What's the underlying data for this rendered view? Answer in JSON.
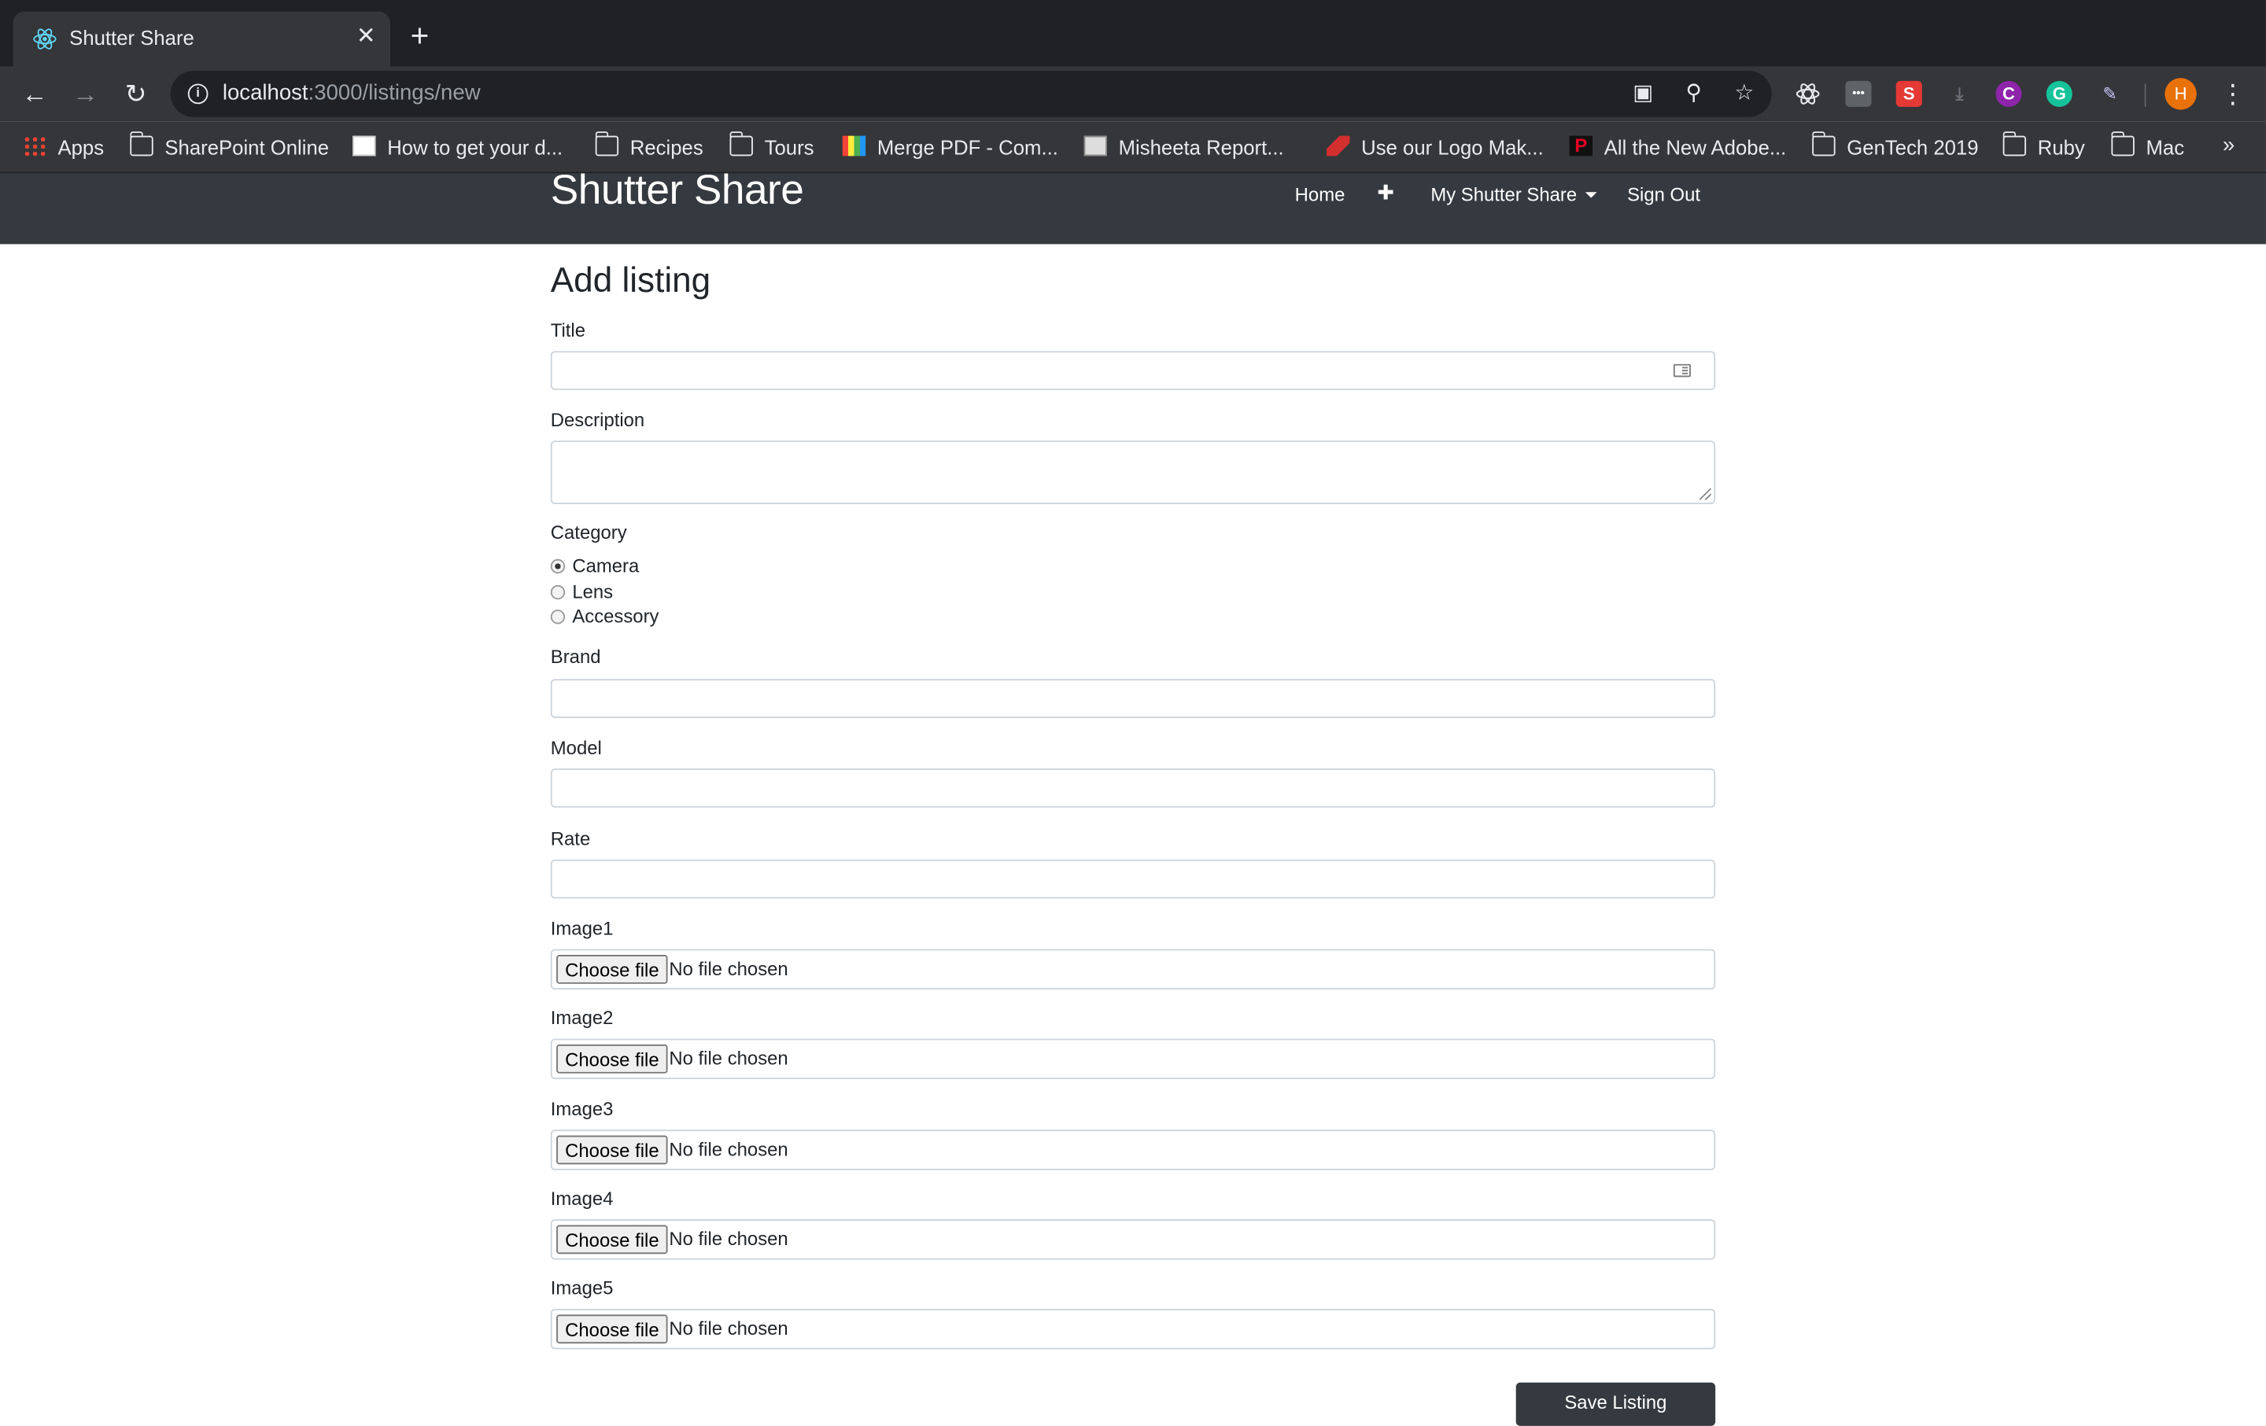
{
  "browser": {
    "tab_title": "Shutter Share",
    "tab_close": "✕",
    "new_tab": "+",
    "url_host": "localhost",
    "url_path": ":3000/listings/new",
    "bookmarks": [
      {
        "label": "Apps",
        "icon": "apps-grid-icon"
      },
      {
        "label": "SharePoint Online",
        "icon": "folder-icon"
      },
      {
        "label": "How to get your d...",
        "icon": "chart-favicon"
      },
      {
        "label": "Recipes",
        "icon": "folder-icon"
      },
      {
        "label": "Tours",
        "icon": "folder-icon"
      },
      {
        "label": "Merge PDF - Com...",
        "icon": "merge-pdf-favicon"
      },
      {
        "label": "Misheeta Report...",
        "icon": "report-favicon"
      },
      {
        "label": "Use our Logo Mak...",
        "icon": "logo-maker-favicon"
      },
      {
        "label": "All the New Adobe...",
        "icon": "adobe-favicon"
      },
      {
        "label": "GenTech 2019",
        "icon": "folder-icon"
      },
      {
        "label": "Ruby",
        "icon": "folder-icon"
      },
      {
        "label": "Mac",
        "icon": "folder-icon"
      }
    ],
    "bookmarks_more": "»",
    "avatar_initial": "H",
    "extensions": {
      "s": "S",
      "c": "C",
      "g": "G",
      "dots": "•••"
    }
  },
  "navbar": {
    "brand": "Shutter Share",
    "home": "Home",
    "add": "✚",
    "my_shutter_share": "My Shutter Share",
    "sign_out": "Sign Out"
  },
  "form": {
    "heading": "Add listing",
    "title_label": "Title",
    "title_value": "",
    "description_label": "Description",
    "description_value": "",
    "category_label": "Category",
    "categories": [
      {
        "label": "Camera",
        "checked": true
      },
      {
        "label": "Lens",
        "checked": false
      },
      {
        "label": "Accessory",
        "checked": false
      }
    ],
    "brand_label": "Brand",
    "model_label": "Model",
    "rate_label": "Rate",
    "images": [
      {
        "label": "Image1",
        "button": "Choose file",
        "status": "No file chosen"
      },
      {
        "label": "Image2",
        "button": "Choose file",
        "status": "No file chosen"
      },
      {
        "label": "Image3",
        "button": "Choose file",
        "status": "No file chosen"
      },
      {
        "label": "Image4",
        "button": "Choose file",
        "status": "No file chosen"
      },
      {
        "label": "Image5",
        "button": "Choose file",
        "status": "No file chosen"
      }
    ],
    "submit": "Save Listing"
  },
  "colors": {
    "navbar_bg": "#343a40",
    "chrome_dark": "#202124",
    "chrome_mid": "#35363a",
    "avatar": "#e8710a"
  }
}
